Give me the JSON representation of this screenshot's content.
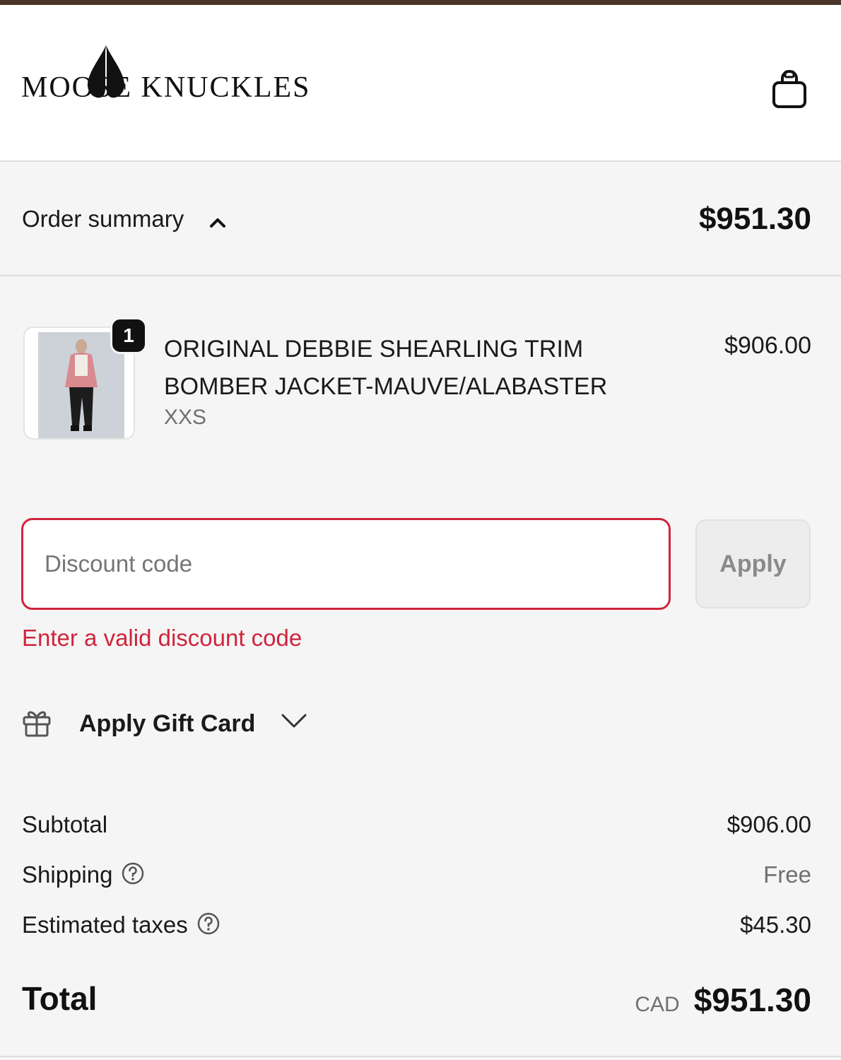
{
  "brand": {
    "logo_text": "MOOSE KNUCKLES"
  },
  "header": {
    "cart_icon": "shopping-bag-icon"
  },
  "order_summary": {
    "label": "Order summary",
    "toggle_icon": "chevron-up-icon",
    "total": "$951.30"
  },
  "line_items": [
    {
      "quantity": "1",
      "name": "ORIGINAL DEBBIE SHEARLING TRIM BOMBER JACKET-MAUVE/ALABASTER",
      "variant": "XXS",
      "price": "$906.00"
    }
  ],
  "discount": {
    "placeholder": "Discount code",
    "value": "",
    "apply_label": "Apply",
    "error": "Enter a valid discount code"
  },
  "gift_card": {
    "label": "Apply Gift Card",
    "icon": "gift-icon",
    "toggle_icon": "chevron-down-icon"
  },
  "totals": {
    "subtotal_label": "Subtotal",
    "subtotal_value": "$906.00",
    "shipping_label": "Shipping",
    "shipping_value": "Free",
    "taxes_label": "Estimated taxes",
    "taxes_value": "$45.30",
    "total_label": "Total",
    "currency": "CAD",
    "total_value": "$951.30"
  },
  "colors": {
    "error": "#d0243c",
    "page_bg": "#f5f5f5",
    "header_strip": "#4a3528"
  }
}
